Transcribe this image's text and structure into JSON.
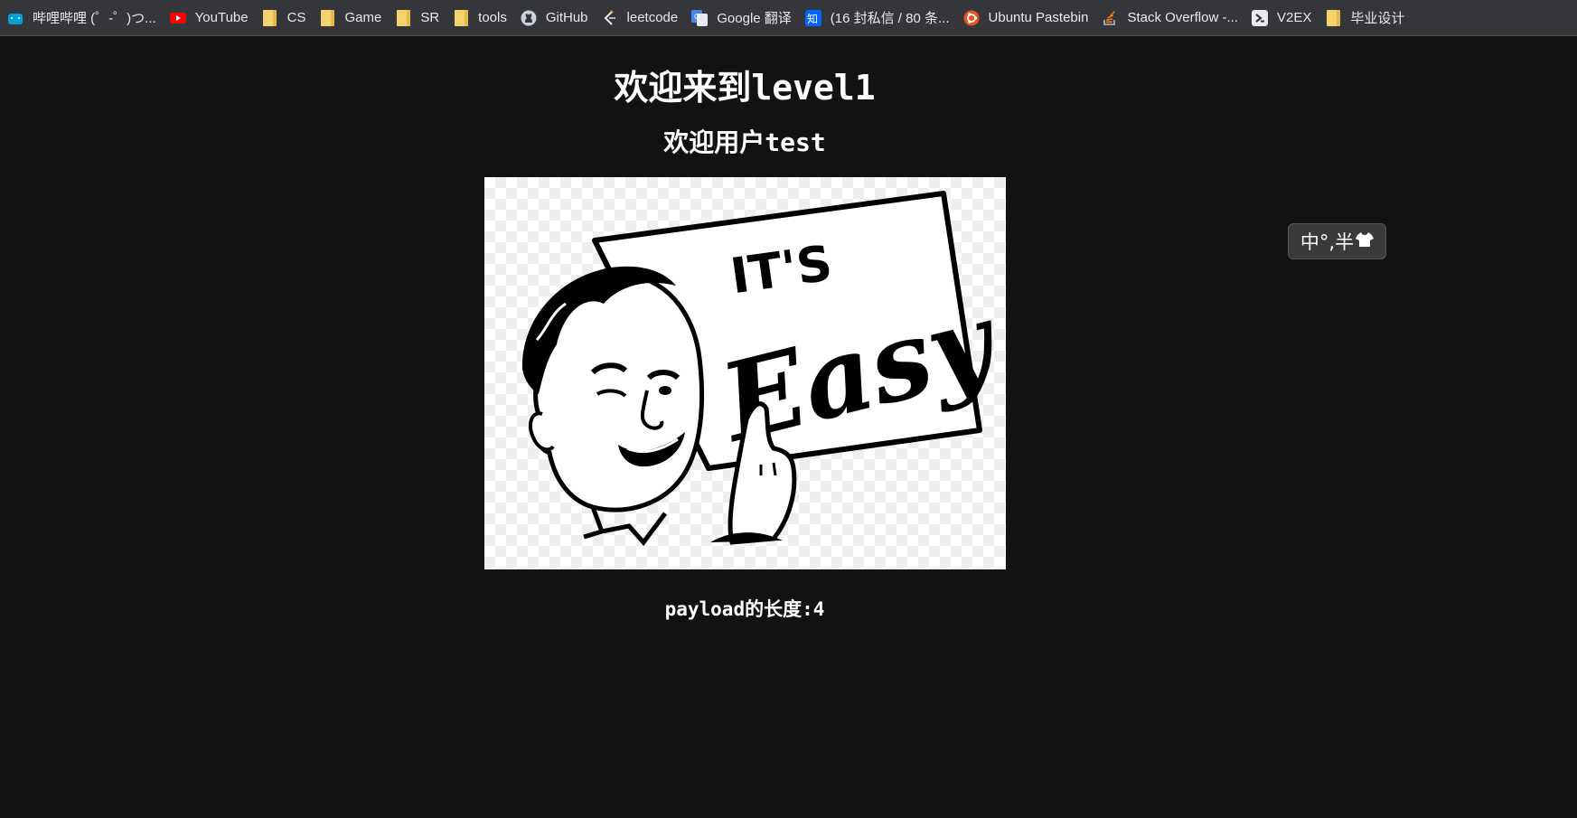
{
  "bookmarks": [
    {
      "label": "哔哩哔哩 (゜-゜)つ...",
      "icon": "bilibili-icon"
    },
    {
      "label": "YouTube",
      "icon": "youtube-icon"
    },
    {
      "label": "CS",
      "icon": "folder-icon"
    },
    {
      "label": "Game",
      "icon": "folder-icon"
    },
    {
      "label": "SR",
      "icon": "folder-icon"
    },
    {
      "label": "tools",
      "icon": "folder-icon"
    },
    {
      "label": "GitHub",
      "icon": "github-icon"
    },
    {
      "label": "leetcode",
      "icon": "leetcode-icon"
    },
    {
      "label": "Google 翻译",
      "icon": "google-translate-icon"
    },
    {
      "label": "(16 封私信 / 80 条...",
      "icon": "zhihu-icon"
    },
    {
      "label": "Ubuntu Pastebin",
      "icon": "ubuntu-icon"
    },
    {
      "label": "Stack Overflow -...",
      "icon": "stackoverflow-icon"
    },
    {
      "label": "V2EX",
      "icon": "v2ex-icon"
    },
    {
      "label": "毕业设计",
      "icon": "folder-icon"
    }
  ],
  "page": {
    "title": "欢迎来到level1",
    "subtitle": "欢迎用户test",
    "image_sign_line1": "IT'S",
    "image_sign_line2": "Easy",
    "payload_text": "payload的长度:4"
  },
  "ime": {
    "label": "中°,半"
  },
  "colors": {
    "background": "#121212",
    "bookmark_bar": "#35363a",
    "text": "#ffffff"
  }
}
